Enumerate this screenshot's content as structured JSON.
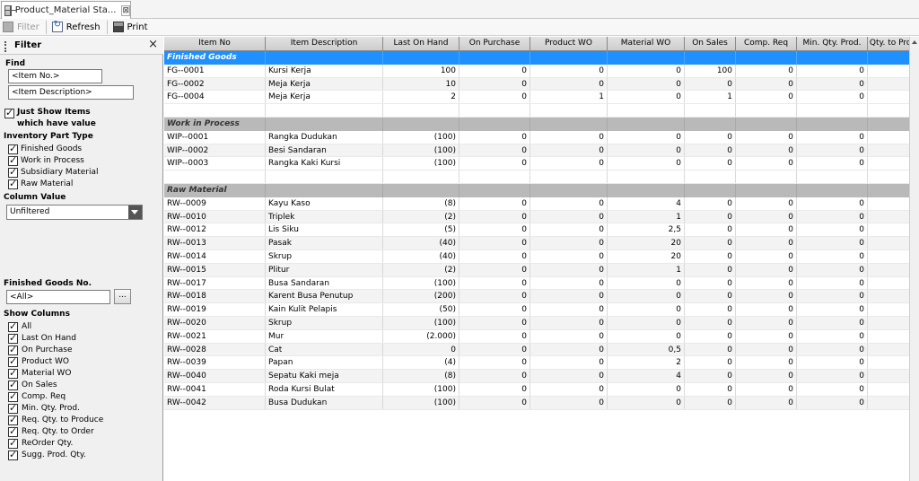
{
  "tab": {
    "title": "Product_Material Sta...",
    "close_glyph": "⊠"
  },
  "toolbar": {
    "filter_label": "Filter",
    "refresh_label": "Refresh",
    "print_label": "Print"
  },
  "filter_panel": {
    "title": "Filter",
    "close_glyph": "×",
    "find_label": "Find",
    "item_no_value": "<Item No.>",
    "item_desc_value": "<Item Description>",
    "just_show_label_1": "Just Show Items",
    "just_show_label_2": "which have value",
    "inventory_type_label": "Inventory Part Type",
    "inventory_types": [
      "Finished Goods",
      "Work in Process",
      "Subsidiary Material",
      "Raw Material"
    ],
    "column_value_label": "Column Value",
    "column_value_selected": "Unfiltered",
    "fg_no_label": "Finished Goods No.",
    "fg_no_value": "<All>",
    "fg_browse_label": "...",
    "show_columns_label": "Show Columns",
    "show_columns": [
      "All",
      "Last On Hand",
      "On Purchase",
      "Product WO",
      "Material WO",
      "On Sales",
      "Comp. Req",
      "Min. Qty. Prod.",
      "Req. Qty. to Produce",
      "Req. Qty. to Order",
      "ReOrder Qty.",
      "Sugg. Prod. Qty."
    ]
  },
  "grid": {
    "columns": [
      "Item No",
      "Item Description",
      "Last On Hand",
      "On Purchase",
      "Product WO",
      "Material WO",
      "On Sales",
      "Comp. Req",
      "Min. Qty. Prod.",
      "Qty. to Prod"
    ],
    "groups": [
      {
        "name": "Finished Goods",
        "rows": [
          [
            "FG--0001",
            "Kursi Kerja",
            "100",
            "0",
            "0",
            "0",
            "100",
            "0",
            "0"
          ],
          [
            "FG--0002",
            "Meja Kerja",
            "10",
            "0",
            "0",
            "0",
            "0",
            "0",
            "0"
          ],
          [
            "FG--0004",
            "Meja Kerja",
            "2",
            "0",
            "1",
            "0",
            "1",
            "0",
            "0"
          ]
        ]
      },
      {
        "name": "Work in Process",
        "rows": [
          [
            "WIP--0001",
            "Rangka Dudukan",
            "(100)",
            "0",
            "0",
            "0",
            "0",
            "0",
            "0"
          ],
          [
            "WIP--0002",
            "Besi Sandaran",
            "(100)",
            "0",
            "0",
            "0",
            "0",
            "0",
            "0"
          ],
          [
            "WIP--0003",
            "Rangka Kaki Kursi",
            "(100)",
            "0",
            "0",
            "0",
            "0",
            "0",
            "0"
          ]
        ]
      },
      {
        "name": "Raw Material",
        "rows": [
          [
            "RW--0009",
            "Kayu Kaso",
            "(8)",
            "0",
            "0",
            "4",
            "0",
            "0",
            "0"
          ],
          [
            "RW--0010",
            "Triplek",
            "(2)",
            "0",
            "0",
            "1",
            "0",
            "0",
            "0"
          ],
          [
            "RW--0012",
            "Lis Siku",
            "(5)",
            "0",
            "0",
            "2,5",
            "0",
            "0",
            "0"
          ],
          [
            "RW--0013",
            "Pasak",
            "(40)",
            "0",
            "0",
            "20",
            "0",
            "0",
            "0"
          ],
          [
            "RW--0014",
            "Skrup",
            "(40)",
            "0",
            "0",
            "20",
            "0",
            "0",
            "0"
          ],
          [
            "RW--0015",
            "Plitur",
            "(2)",
            "0",
            "0",
            "1",
            "0",
            "0",
            "0"
          ],
          [
            "RW--0017",
            "Busa Sandaran",
            "(100)",
            "0",
            "0",
            "0",
            "0",
            "0",
            "0"
          ],
          [
            "RW--0018",
            "Karent Busa Penutup",
            "(200)",
            "0",
            "0",
            "0",
            "0",
            "0",
            "0"
          ],
          [
            "RW--0019",
            "Kain Kulit Pelapis",
            "(50)",
            "0",
            "0",
            "0",
            "0",
            "0",
            "0"
          ],
          [
            "RW--0020",
            "Skrup",
            "(100)",
            "0",
            "0",
            "0",
            "0",
            "0",
            "0"
          ],
          [
            "RW--0021",
            "Mur",
            "(2.000)",
            "0",
            "0",
            "0",
            "0",
            "0",
            "0"
          ],
          [
            "RW--0028",
            "Cat",
            "0",
            "0",
            "0",
            "0,5",
            "0",
            "0",
            "0"
          ],
          [
            "RW--0039",
            "Papan",
            "(4)",
            "0",
            "0",
            "2",
            "0",
            "0",
            "0"
          ],
          [
            "RW--0040",
            "Sepatu Kaki meja",
            "(8)",
            "0",
            "0",
            "4",
            "0",
            "0",
            "0"
          ],
          [
            "RW--0041",
            "Roda Kursi Bulat",
            "(100)",
            "0",
            "0",
            "0",
            "0",
            "0",
            "0"
          ],
          [
            "RW--0042",
            "Busa Dudukan",
            "(100)",
            "0",
            "0",
            "0",
            "0",
            "0",
            "0"
          ]
        ]
      }
    ]
  },
  "colors": {
    "selected_group": "#1e90ff",
    "group_band": "#b9b9b9"
  }
}
